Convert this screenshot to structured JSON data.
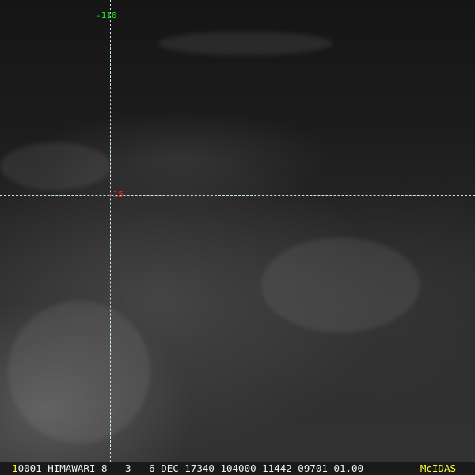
{
  "image": {
    "type": "satellite visible imagery",
    "colors": {
      "grid": "#c8e8e8",
      "lon_label": "#22ee22",
      "lat_label": "#ff2020",
      "logo": "#ffff33"
    }
  },
  "grid": {
    "longitude_label": "-110",
    "latitude_label": "-15"
  },
  "status_bar": {
    "frame_number": "1",
    "text": "0001 HIMAWARI-8   3   6 DEC 17340 104000 11442 09701 01.00",
    "logo": "McIDAS"
  }
}
